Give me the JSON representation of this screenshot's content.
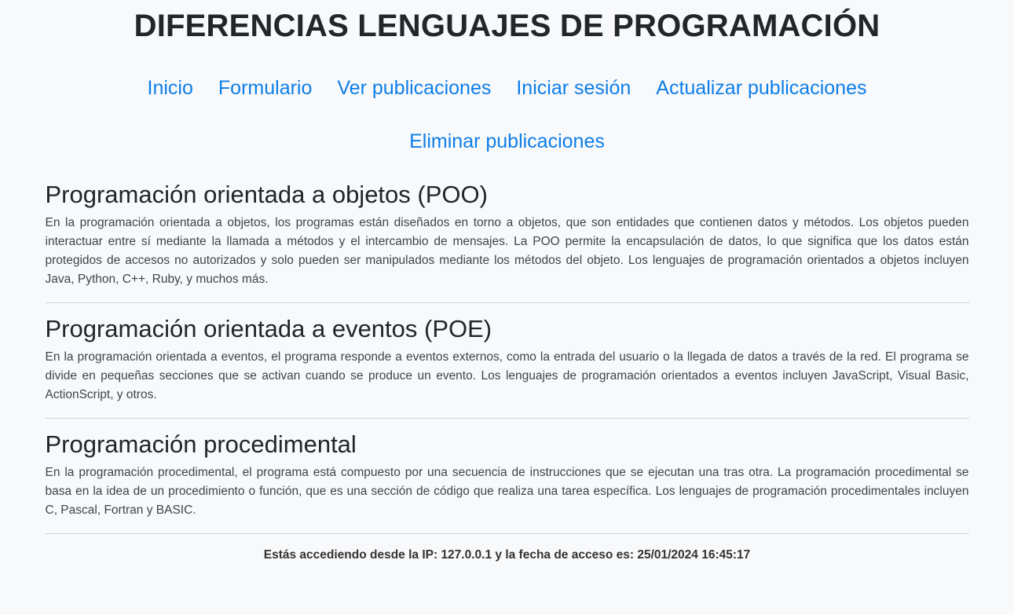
{
  "header": {
    "title": "DIFERENCIAS LENGUAJES DE PROGRAMACIÓN"
  },
  "nav": {
    "items": [
      {
        "label": "Inicio"
      },
      {
        "label": "Formulario"
      },
      {
        "label": "Ver publicaciones"
      },
      {
        "label": "Iniciar sesión"
      },
      {
        "label": "Actualizar publicaciones"
      },
      {
        "label": "Eliminar publicaciones"
      }
    ]
  },
  "sections": [
    {
      "heading": "Programación orientada a objetos (POO)",
      "body": "En la programación orientada a objetos, los programas están diseñados en torno a objetos, que son entidades que contienen datos y métodos. Los objetos pueden interactuar entre sí mediante la llamada a métodos y el intercambio de mensajes. La POO permite la encapsulación de datos, lo que significa que los datos están protegidos de accesos no autorizados y solo pueden ser manipulados mediante los métodos del objeto. Los lenguajes de programación orientados a objetos incluyen Java, Python, C++, Ruby, y muchos más."
    },
    {
      "heading": "Programación orientada a eventos (POE)",
      "body": "En la programación orientada a eventos, el programa responde a eventos externos, como la entrada del usuario o la llegada de datos a través de la red. El programa se divide en pequeñas secciones que se activan cuando se produce un evento. Los lenguajes de programación orientados a eventos incluyen JavaScript, Visual Basic, ActionScript, y otros."
    },
    {
      "heading": "Programación procedimental",
      "body": "En la programación procedimental, el programa está compuesto por una secuencia de instrucciones que se ejecutan una tras otra. La programación procedimental se basa en la idea de un procedimiento o función, que es una sección de código que realiza una tarea específica. Los lenguajes de programación procedimentales incluyen C, Pascal, Fortran y BASIC."
    }
  ],
  "footer": {
    "access_text": "Estás accediendo desde la IP: 127.0.0.1 y la fecha de acceso es: 25/01/2024 16:45:17"
  },
  "colors": {
    "link": "#0d7ee8",
    "background": "#f8f9fb",
    "text": "#212529"
  }
}
